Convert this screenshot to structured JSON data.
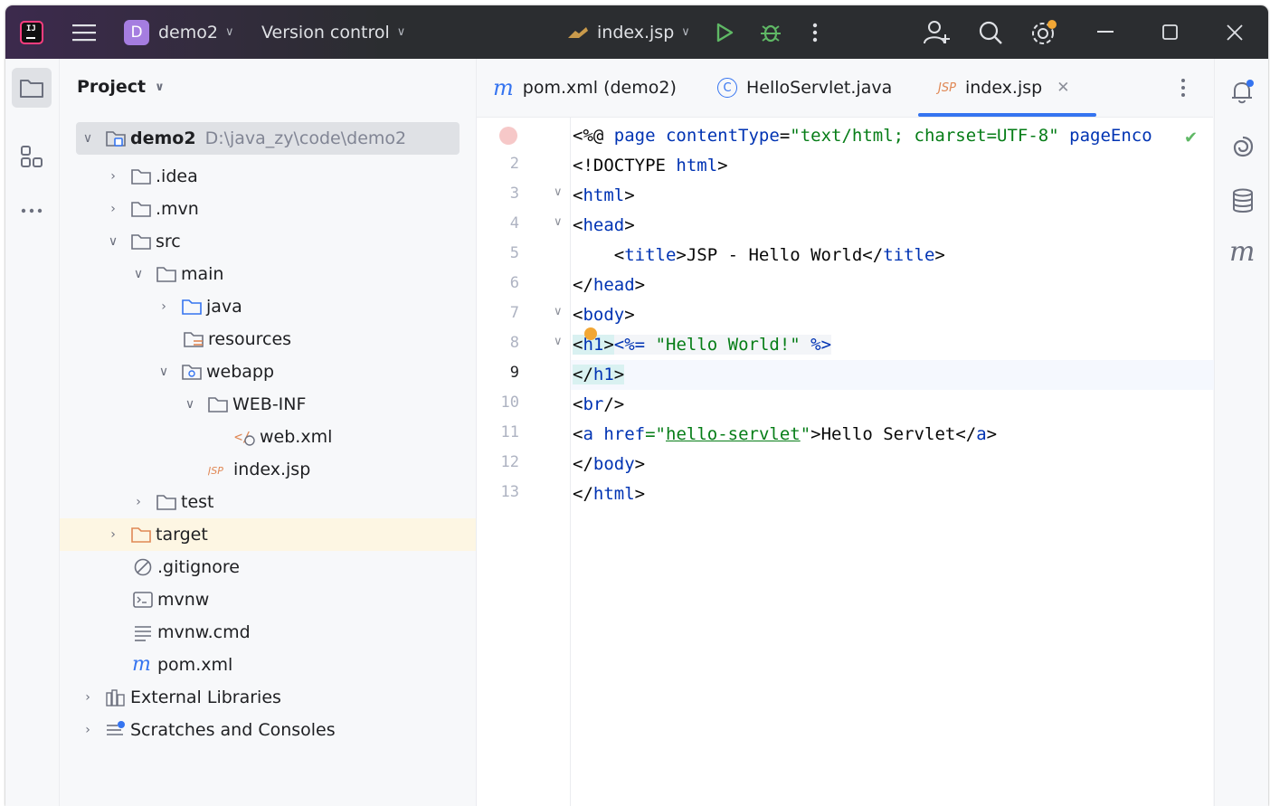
{
  "titlebar": {
    "project_badge": "D",
    "project_name": "demo2",
    "vcs_label": "Version control",
    "run_config": "index.jsp"
  },
  "project_panel": {
    "title": "Project",
    "tree": [
      {
        "label": "demo2",
        "path": "D:\\java_zy\\code\\demo2",
        "icon": "module-folder-icon"
      },
      {
        "label": ".idea",
        "icon": "folder-icon"
      },
      {
        "label": ".mvn",
        "icon": "folder-icon"
      },
      {
        "label": "src",
        "icon": "folder-icon"
      },
      {
        "label": "main",
        "icon": "folder-icon"
      },
      {
        "label": "java",
        "icon": "source-folder-icon"
      },
      {
        "label": "resources",
        "icon": "resources-folder-icon"
      },
      {
        "label": "webapp",
        "icon": "web-folder-icon"
      },
      {
        "label": "WEB-INF",
        "icon": "folder-icon"
      },
      {
        "label": "web.xml",
        "icon": "xml-file-icon"
      },
      {
        "label": "index.jsp",
        "icon": "jsp-file-icon"
      },
      {
        "label": "test",
        "icon": "folder-icon"
      },
      {
        "label": "target",
        "icon": "excluded-folder-icon"
      },
      {
        "label": ".gitignore",
        "icon": "ignore-file-icon"
      },
      {
        "label": "mvnw",
        "icon": "shell-file-icon"
      },
      {
        "label": "mvnw.cmd",
        "icon": "text-file-icon"
      },
      {
        "label": "pom.xml",
        "icon": "maven-file-icon"
      },
      {
        "label": "External Libraries",
        "icon": "libraries-icon"
      },
      {
        "label": "Scratches and Consoles",
        "icon": "scratches-icon"
      }
    ]
  },
  "tabs": [
    {
      "label": "pom.xml (demo2)",
      "icon_text": "m"
    },
    {
      "label": "HelloServlet.java",
      "icon_text": "C"
    },
    {
      "label": "index.jsp",
      "icon_text": "JSP"
    }
  ],
  "editor": {
    "line_numbers": [
      "2",
      "3",
      "4",
      "5",
      "6",
      "7",
      "8",
      "9",
      "10",
      "11",
      "12",
      "13"
    ],
    "current_line": "9",
    "lines": {
      "l1": {
        "a": "<%@ ",
        "b": "page ",
        "c": "contentType",
        "d": "=",
        "e": "\"text/html; charset=UTF-8\"",
        "f": " pageEnco"
      },
      "l2": {
        "a": "<!DOCTYPE ",
        "b": "html",
        "c": ">"
      },
      "l3": {
        "a": "<",
        "b": "html",
        "c": ">"
      },
      "l4": {
        "a": "<",
        "b": "head",
        "c": ">"
      },
      "l5": {
        "a": "    <",
        "b": "title",
        "c": ">JSP - Hello World</",
        "d": "title",
        "e": ">"
      },
      "l6": {
        "a": "</",
        "b": "head",
        "c": ">"
      },
      "l7": {
        "a": "<",
        "b": "body",
        "c": ">"
      },
      "l8": {
        "a": "<",
        "b": "h1",
        "c": ">",
        "d": "<%=",
        "e": " \"Hello World!\" ",
        "f": "%>"
      },
      "l9": {
        "a": "</",
        "b": "h1",
        "c": ">"
      },
      "l10": {
        "a": "<",
        "b": "br",
        "c": "/>"
      },
      "l11": {
        "a": "<",
        "b": "a ",
        "c": "href",
        "d": "=\"",
        "e": "hello-servlet",
        "f": "\"",
        "g": ">Hello Servlet</",
        "h": "a",
        "i": ">"
      },
      "l12": {
        "a": "</",
        "b": "body",
        "c": ">"
      },
      "l13": {
        "a": "</",
        "b": "html",
        "c": ">"
      }
    }
  },
  "colors": {
    "accent": "#3574f0",
    "tag": "#0033b3",
    "string": "#067d17",
    "run": "#5fb865",
    "debug": "#5fb865",
    "excluded_highlight": "#fdf6e3"
  }
}
